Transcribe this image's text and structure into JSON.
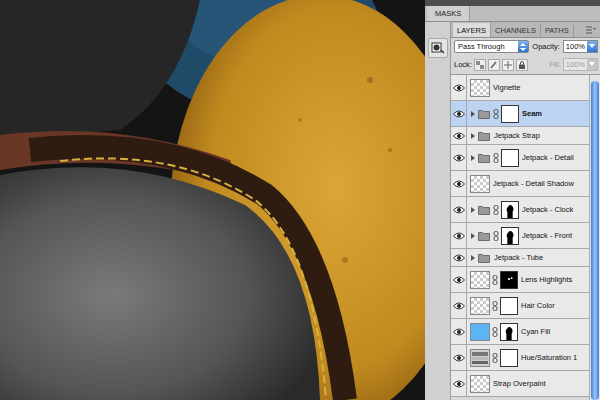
{
  "panel_strip": {
    "tab": "MASKS"
  },
  "tabs": [
    {
      "label": "LAYERS",
      "selected": true
    },
    {
      "label": "CHANNELS",
      "selected": false
    },
    {
      "label": "PATHS",
      "selected": false
    }
  ],
  "blend_mode": "Pass Through",
  "opacity": {
    "label": "Opacity:",
    "value": "100%"
  },
  "lock": {
    "label": "Lock:"
  },
  "fill": {
    "label": "Fill:",
    "value": "100%",
    "disabled": true
  },
  "layers": [
    {
      "name": "Vignette",
      "kind": "layer",
      "visible": true,
      "selected": false,
      "expanded": false,
      "mask": "none"
    },
    {
      "name": "Seam",
      "kind": "group",
      "visible": true,
      "selected": true,
      "expanded": false,
      "mask": "white"
    },
    {
      "name": "Jetpack Strap",
      "kind": "group",
      "visible": true,
      "selected": false,
      "expanded": false,
      "mask": "none"
    },
    {
      "name": "Jetpack - Detail",
      "kind": "group",
      "visible": true,
      "selected": false,
      "expanded": false,
      "mask": "white"
    },
    {
      "name": "Jetpack - Detail Shadow",
      "kind": "layer",
      "visible": true,
      "selected": false,
      "expanded": false,
      "mask": "none"
    },
    {
      "name": "Jetpack - Clock",
      "kind": "group",
      "visible": true,
      "selected": false,
      "expanded": false,
      "mask": "silhouette"
    },
    {
      "name": "Jetpack - Front",
      "kind": "group",
      "visible": true,
      "selected": false,
      "expanded": false,
      "mask": "silhouette"
    },
    {
      "name": "Jetpack - Tube",
      "kind": "group",
      "visible": true,
      "selected": false,
      "expanded": false,
      "mask": "none"
    },
    {
      "name": "Lens Highlights",
      "kind": "layer",
      "visible": true,
      "selected": false,
      "expanded": false,
      "mask": "black"
    },
    {
      "name": "Hair Color",
      "kind": "layer",
      "visible": true,
      "selected": false,
      "expanded": false,
      "mask": "white"
    },
    {
      "name": "Cyan Fill",
      "kind": "fill",
      "visible": true,
      "selected": false,
      "expanded": false,
      "mask": "silhouette",
      "color": "#5ab4f5"
    },
    {
      "name": "Hue/Saturation 1",
      "kind": "adjustment",
      "visible": true,
      "selected": false,
      "expanded": false,
      "mask": "white"
    },
    {
      "name": "Strap Overpaint",
      "kind": "layer",
      "visible": true,
      "selected": false,
      "expanded": false,
      "mask": "none"
    }
  ]
}
